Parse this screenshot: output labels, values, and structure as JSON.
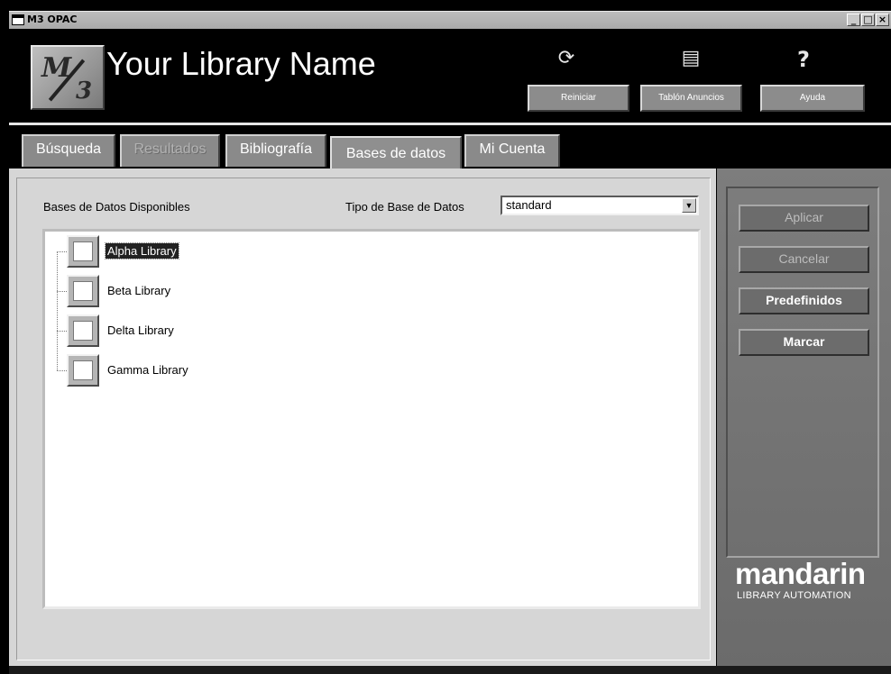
{
  "window": {
    "title": "M3 OPAC",
    "controls": {
      "minimize": "_",
      "maximize": "□",
      "close": "×"
    }
  },
  "header": {
    "logo": {
      "m": "M",
      "three": "3"
    },
    "library_name": "Your Library Name",
    "buttons": [
      {
        "label": "Reiniciar",
        "icon": "refresh-icon",
        "glyph": "⟳"
      },
      {
        "label": "Tablón Anuncios",
        "icon": "notice-board-icon",
        "glyph": "▤"
      },
      {
        "label": "Ayuda",
        "icon": "help-icon",
        "glyph": "?"
      }
    ]
  },
  "tabs": [
    {
      "label": "Búsqueda",
      "state": "normal"
    },
    {
      "label": "Resultados",
      "state": "disabled"
    },
    {
      "label": "Bibliografía",
      "state": "normal"
    },
    {
      "label": "Bases de datos",
      "state": "active"
    },
    {
      "label": "Mi Cuenta",
      "state": "normal"
    }
  ],
  "databases": {
    "available_label": "Bases de Datos Disponibles",
    "type_label": "Tipo de Base de Datos",
    "type_value": "standard",
    "items": [
      {
        "label": "Alpha Library",
        "checked": false,
        "selected": true
      },
      {
        "label": "Beta Library",
        "checked": false,
        "selected": false
      },
      {
        "label": "Delta Library",
        "checked": false,
        "selected": false
      },
      {
        "label": "Gamma Library",
        "checked": false,
        "selected": false
      }
    ]
  },
  "actions": [
    {
      "label": "Aplicar",
      "enabled": false
    },
    {
      "label": "Cancelar",
      "enabled": false
    },
    {
      "label": "Predefinidos",
      "enabled": true
    },
    {
      "label": "Marcar",
      "enabled": true
    }
  ],
  "branding": {
    "name": "mandarin",
    "tagline": "LIBRARY AUTOMATION"
  }
}
